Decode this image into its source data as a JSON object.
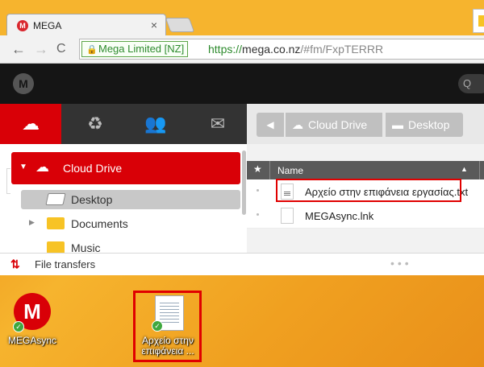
{
  "browser": {
    "tab_title": "MEGA",
    "tab_favicon": "M",
    "tab_close": "×",
    "ev_cert": "Mega Limited [NZ]",
    "url_scheme": "https://",
    "url_host": "mega.co.nz",
    "url_path": "/#fm/FxpTERRR",
    "back_icon": "←",
    "forward_icon": "→",
    "reload_icon": "C"
  },
  "mega": {
    "logo": "M",
    "search_icon": "Q",
    "left_tabs": [
      {
        "icon": "cloud-icon",
        "glyph": "☁"
      },
      {
        "icon": "recycle-bin-icon",
        "glyph": "♻"
      },
      {
        "icon": "contacts-icon",
        "glyph": "👥"
      },
      {
        "icon": "inbox-icon",
        "glyph": "✉"
      }
    ],
    "tree": {
      "root_label": "Cloud Drive",
      "items": [
        {
          "label": "Desktop",
          "selected": true
        },
        {
          "label": "Documents",
          "selected": false
        },
        {
          "label": "Music",
          "selected": false
        }
      ]
    },
    "breadcrumb": [
      {
        "label": "Cloud Drive",
        "icon": "cloud-icon"
      },
      {
        "label": "Desktop",
        "icon": "folder-icon"
      }
    ],
    "list_header": {
      "star": "★",
      "name": "Name",
      "sort_icon": "▲"
    },
    "files": [
      {
        "name": "Αρχείο στην επιφάνεια εργασίας.txt",
        "icon": "text-file-icon"
      },
      {
        "name": "MEGAsync.lnk",
        "icon": "file-icon"
      }
    ],
    "transfers": {
      "label": "File transfers",
      "icon": "transfer-arrows-icon",
      "glyph": "⇅",
      "more": "•••"
    }
  },
  "desktop": {
    "icons": [
      {
        "label": "MEGAsync",
        "icon": "megasync-icon",
        "badge": "✓"
      },
      {
        "label_line1": "Αρχείο στην",
        "label_line2": "επιφάνεια ...",
        "icon": "text-file-icon",
        "badge": "✓"
      }
    ]
  }
}
